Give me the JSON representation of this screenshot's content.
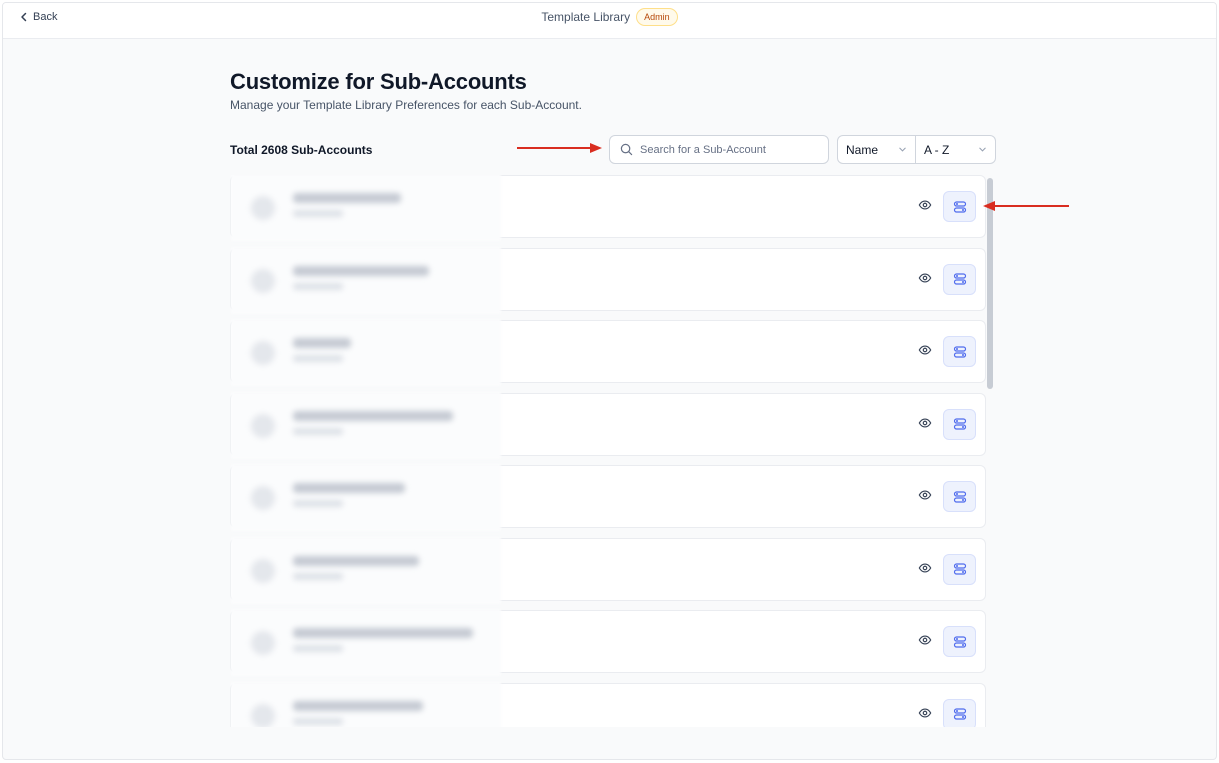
{
  "header": {
    "back_label": "Back",
    "title": "Template Library",
    "badge": "Admin"
  },
  "page": {
    "heading": "Customize for Sub-Accounts",
    "subheading": "Manage your Template Library Preferences for each Sub-Account.",
    "total": "Total 2608 Sub-Accounts"
  },
  "search": {
    "placeholder": "Search for a Sub-Account",
    "icon": "search-icon"
  },
  "sort": {
    "field": "Name",
    "order": "A - Z"
  },
  "rows": [
    {
      "name_blurred": true
    },
    {
      "name_blurred": true
    },
    {
      "name_blurred": true
    },
    {
      "name_blurred": true
    },
    {
      "name_blurred": true
    },
    {
      "name_blurred": true
    },
    {
      "name_blurred": true
    },
    {
      "name_blurred": true
    }
  ],
  "colors": {
    "accent": "#4f6bed",
    "annotation_arrow": "#d92d20",
    "badge_text": "#b54708",
    "badge_bg": "#fffaeb"
  }
}
